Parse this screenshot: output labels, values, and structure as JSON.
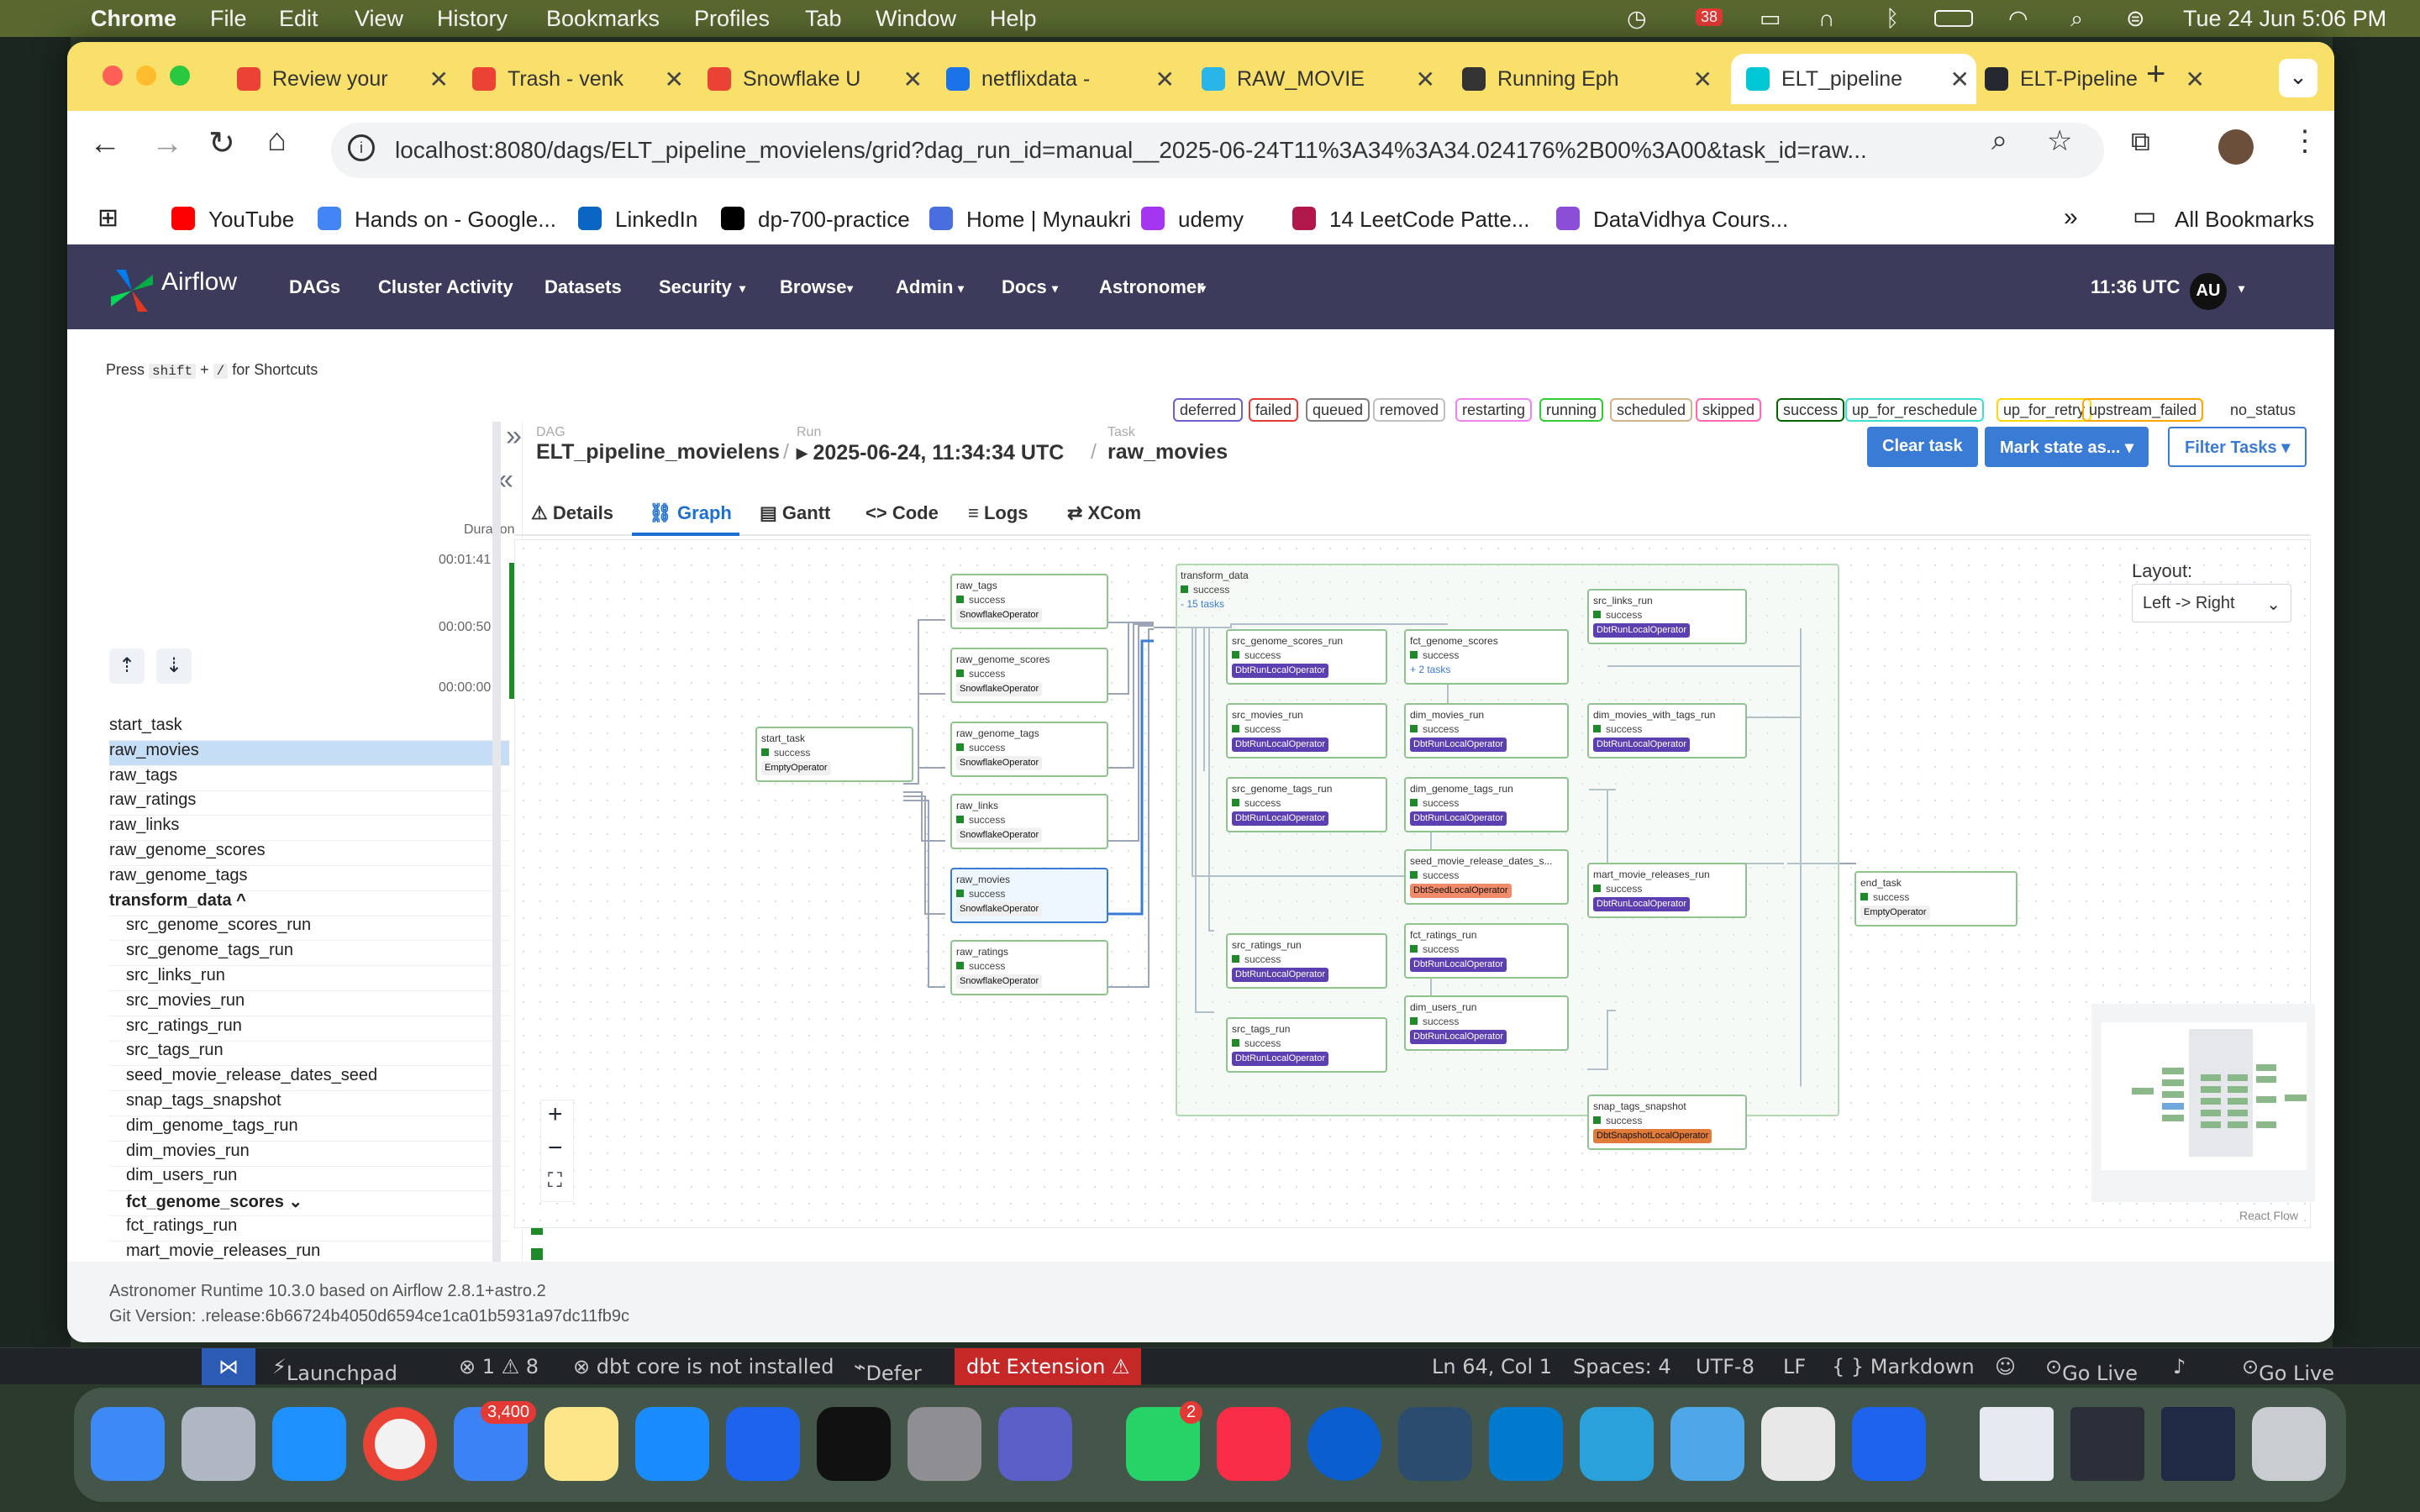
{
  "menubar": {
    "app": "Chrome",
    "items": [
      "File",
      "Edit",
      "View",
      "History",
      "Bookmarks",
      "Profiles",
      "Tab",
      "Window",
      "Help"
    ],
    "datetime": "Tue 24 Jun  5:06 PM",
    "notif_count": "38"
  },
  "tabs": [
    {
      "title": "Review your",
      "color": "#ea4335"
    },
    {
      "title": "Trash - venk",
      "color": "#ea4335"
    },
    {
      "title": "Snowflake U",
      "color": "#ea4335"
    },
    {
      "title": "netflixdata -",
      "color": "#1a73e8"
    },
    {
      "title": "RAW_MOVIE",
      "color": "#29b5e8"
    },
    {
      "title": "Running Eph",
      "color": "#333333"
    },
    {
      "title": "ELT_pipeline",
      "color": "#00c7d4"
    },
    {
      "title": "ELT-Pipeline",
      "color": "#24292f"
    }
  ],
  "address": {
    "url": "localhost:8080/dags/ELT_pipeline_movielens/grid?dag_run_id=manual__2025-06-24T11%3A34%3A34.024176%2B00%3A00&task_id=raw..."
  },
  "bookmarks": [
    {
      "label": "YouTube",
      "color": "#ff0000"
    },
    {
      "label": "Hands on - Google...",
      "color": "#4285f4"
    },
    {
      "label": "LinkedIn",
      "color": "#0a66c2"
    },
    {
      "label": "dp-700-practice",
      "color": "#000000"
    },
    {
      "label": "Home | Mynaukri",
      "color": "#4a6ee0"
    },
    {
      "label": "udemy",
      "color": "#a435f0"
    },
    {
      "label": "14 LeetCode Patte...",
      "color": "#b0174a"
    },
    {
      "label": "DataVidhya Cours...",
      "color": "#8a4fd6"
    }
  ],
  "all_bookmarks": "All Bookmarks",
  "airflow": {
    "brand": "Airflow",
    "nav": [
      "DAGs",
      "Cluster Activity",
      "Datasets",
      "Security",
      "Browse",
      "Admin",
      "Docs",
      "Astronomer"
    ],
    "time": "11:36 UTC",
    "user": "AU"
  },
  "shortcut_hint": {
    "press": "Press",
    "key1": "shift",
    "plus": "+",
    "key2": "/",
    "rest": "for Shortcuts"
  },
  "legend": [
    {
      "label": "deferred",
      "color": "#6b5ecf"
    },
    {
      "label": "failed",
      "color": "#e53935"
    },
    {
      "label": "queued",
      "color": "#808080"
    },
    {
      "label": "removed",
      "color": "#c0c0c0"
    },
    {
      "label": "restarting",
      "color": "#ee82ee"
    },
    {
      "label": "running",
      "color": "#32cd32"
    },
    {
      "label": "scheduled",
      "color": "#d2b48c"
    },
    {
      "label": "skipped",
      "color": "#ff69b4"
    },
    {
      "label": "success",
      "color": "#006400"
    },
    {
      "label": "up_for_reschedule",
      "color": "#40e0d0"
    },
    {
      "label": "up_for_retry",
      "color": "#ffd700"
    },
    {
      "label": "upstream_failed",
      "color": "#ffa500"
    },
    {
      "label": "no_status",
      "color": "#ffffff"
    }
  ],
  "grid": {
    "duration_label": "Duration",
    "durations": [
      "00:01:41",
      "00:00:50",
      "00:00:00"
    ],
    "tasks": [
      {
        "name": "start_task",
        "type": "plain"
      },
      {
        "name": "raw_movies",
        "type": "selected"
      },
      {
        "name": "raw_tags",
        "type": "plain"
      },
      {
        "name": "raw_ratings",
        "type": "plain"
      },
      {
        "name": "raw_links",
        "type": "plain"
      },
      {
        "name": "raw_genome_scores",
        "type": "plain"
      },
      {
        "name": "raw_genome_tags",
        "type": "plain"
      },
      {
        "name": "transform_data ^",
        "type": "bold"
      },
      {
        "name": "src_genome_scores_run",
        "type": "sub"
      },
      {
        "name": "src_genome_tags_run",
        "type": "sub"
      },
      {
        "name": "src_links_run",
        "type": "sub"
      },
      {
        "name": "src_movies_run",
        "type": "sub"
      },
      {
        "name": "src_ratings_run",
        "type": "sub"
      },
      {
        "name": "src_tags_run",
        "type": "sub"
      },
      {
        "name": "seed_movie_release_dates_seed",
        "type": "sub"
      },
      {
        "name": "snap_tags_snapshot",
        "type": "sub"
      },
      {
        "name": "dim_genome_tags_run",
        "type": "sub"
      },
      {
        "name": "dim_movies_run",
        "type": "sub"
      },
      {
        "name": "dim_users_run",
        "type": "sub"
      },
      {
        "name": "fct_genome_scores ⌄",
        "type": "subbold"
      },
      {
        "name": "fct_ratings_run",
        "type": "sub"
      },
      {
        "name": "mart_movie_releases_run",
        "type": "sub"
      },
      {
        "name": "dim_movies_with_tags_run",
        "type": "sub"
      },
      {
        "name": "end_task",
        "type": "plain"
      }
    ]
  },
  "breadcrumb": {
    "dag_label": "DAG",
    "dag": "ELT_pipeline_movielens",
    "run_label": "Run",
    "run": "▸ 2025-06-24, 11:34:34 UTC",
    "task_label": "Task",
    "task": "raw_movies"
  },
  "actions": {
    "clear": "Clear task",
    "mark": "Mark state as... ▾",
    "filter": "Filter Tasks ▾"
  },
  "detail_tabs": [
    "Details",
    "Graph",
    "Gantt",
    "Code",
    "Logs",
    "XCom"
  ],
  "graph": {
    "layout_label": "Layout:",
    "layout_value": "Left -> Right",
    "react_flow": "React Flow",
    "group": {
      "name": "transform_data",
      "status": "success",
      "more": "- 15 tasks"
    },
    "nodes": [
      {
        "name": "start_task",
        "status": "success",
        "op": "EmptyOperator",
        "kind": "plain"
      },
      {
        "name": "raw_tags",
        "status": "success",
        "op": "SnowflakeOperator",
        "kind": "plain"
      },
      {
        "name": "raw_genome_scores",
        "status": "success",
        "op": "SnowflakeOperator",
        "kind": "plain"
      },
      {
        "name": "raw_genome_tags",
        "status": "success",
        "op": "SnowflakeOperator",
        "kind": "plain"
      },
      {
        "name": "raw_links",
        "status": "success",
        "op": "SnowflakeOperator",
        "kind": "plain"
      },
      {
        "name": "raw_movies",
        "status": "success",
        "op": "SnowflakeOperator",
        "kind": "plain"
      },
      {
        "name": "raw_ratings",
        "status": "success",
        "op": "SnowflakeOperator",
        "kind": "plain"
      },
      {
        "name": "src_genome_scores_run",
        "status": "success",
        "op": "DbtRunLocalOperator",
        "kind": "dbt"
      },
      {
        "name": "src_movies_run",
        "status": "success",
        "op": "DbtRunLocalOperator",
        "kind": "dbt"
      },
      {
        "name": "src_genome_tags_run",
        "status": "success",
        "op": "DbtRunLocalOperator",
        "kind": "dbt"
      },
      {
        "name": "src_ratings_run",
        "status": "success",
        "op": "DbtRunLocalOperator",
        "kind": "dbt"
      },
      {
        "name": "src_tags_run",
        "status": "success",
        "op": "DbtRunLocalOperator",
        "kind": "dbt"
      },
      {
        "name": "fct_genome_scores",
        "status": "success",
        "op": "+ 2 tasks",
        "kind": "more"
      },
      {
        "name": "dim_movies_run",
        "status": "success",
        "op": "DbtRunLocalOperator",
        "kind": "dbt"
      },
      {
        "name": "dim_genome_tags_run",
        "status": "success",
        "op": "DbtRunLocalOperator",
        "kind": "dbt"
      },
      {
        "name": "seed_movie_release_dates_s...",
        "status": "success",
        "op": "DbtSeedLocalOperator",
        "kind": "seed"
      },
      {
        "name": "fct_ratings_run",
        "status": "success",
        "op": "DbtRunLocalOperator",
        "kind": "dbt"
      },
      {
        "name": "dim_users_run",
        "status": "success",
        "op": "DbtRunLocalOperator",
        "kind": "dbt"
      },
      {
        "name": "src_links_run",
        "status": "success",
        "op": "DbtRunLocalOperator",
        "kind": "dbt"
      },
      {
        "name": "dim_movies_with_tags_run",
        "status": "success",
        "op": "DbtRunLocalOperator",
        "kind": "dbt"
      },
      {
        "name": "mart_movie_releases_run",
        "status": "success",
        "op": "DbtRunLocalOperator",
        "kind": "dbt"
      },
      {
        "name": "snap_tags_snapshot",
        "status": "success",
        "op": "DbtSnapshotLocalOperator",
        "kind": "snap"
      },
      {
        "name": "end_task",
        "status": "success",
        "op": "EmptyOperator",
        "kind": "plain"
      }
    ]
  },
  "footer": {
    "runtime": "Astronomer Runtime 10.3.0 based on Airflow 2.8.1+astro.2",
    "git": "Git Version: .release:6b66724b4050d6594ce1ca01b5931a97dc11fb9c"
  },
  "vscode": {
    "launchpad": "Launchpad",
    "problems": "⊗ 1 ⚠ 8",
    "dbt": "⊗ dbt core is not installed",
    "defer": "Defer",
    "ext": "dbt Extension ⚠",
    "pos": "Ln 64, Col 1",
    "spaces": "Spaces: 4",
    "enc": "UTF-8",
    "eol": "LF",
    "lang": "{ } Markdown",
    "golive1": "Go Live",
    "golive2": "Go Live"
  },
  "dock": {
    "mail_badge": "3,400",
    "whatsapp_badge": "2"
  }
}
